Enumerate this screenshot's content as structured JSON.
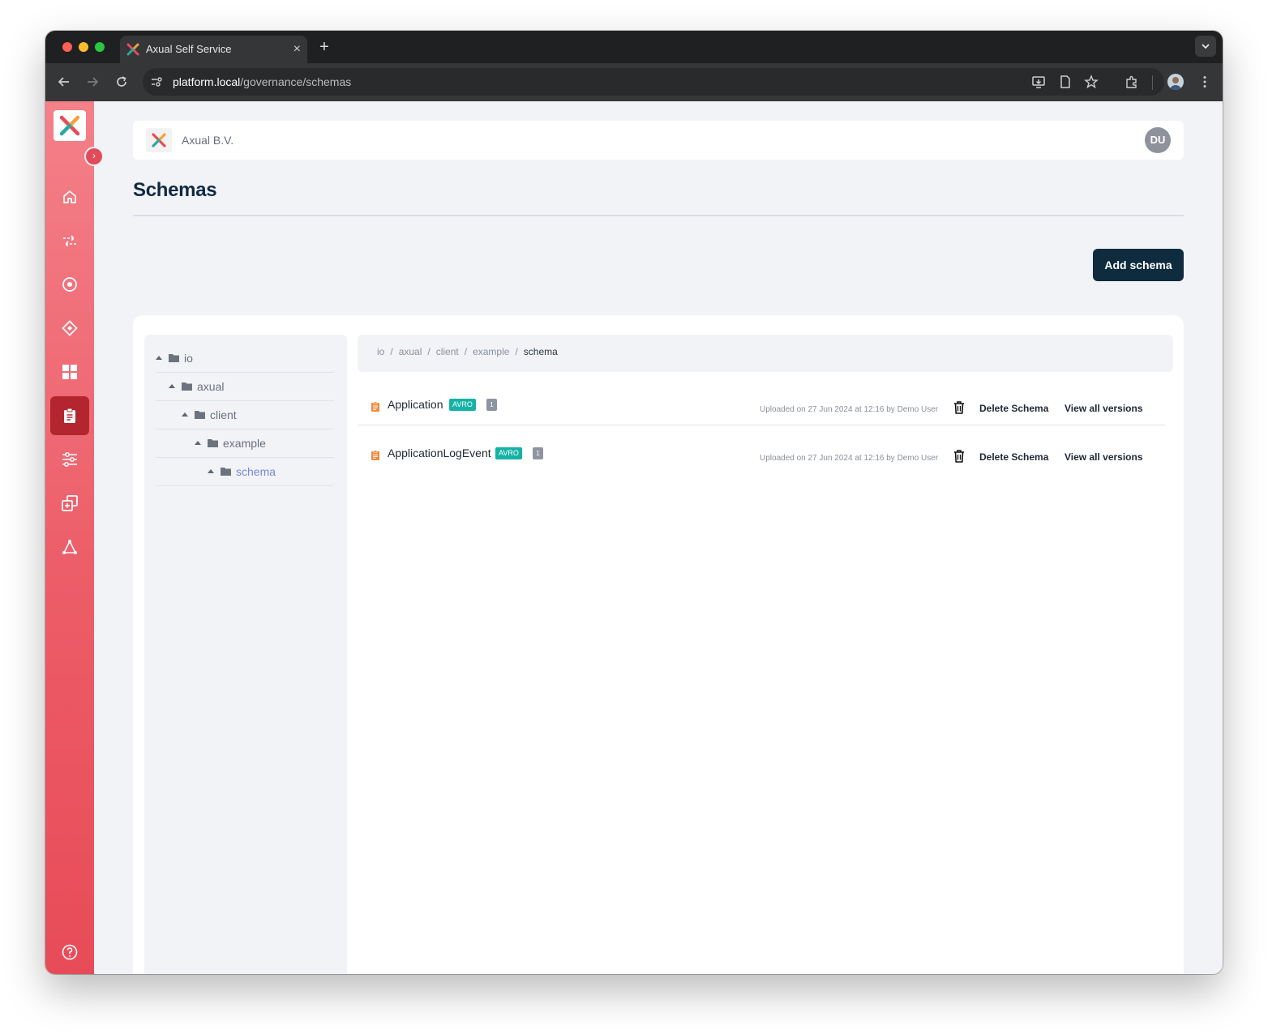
{
  "browser": {
    "tab_title": "Axual Self Service",
    "tab_close": "×",
    "new_tab": "+",
    "url_host": "platform.local",
    "url_path": "/governance/schemas"
  },
  "sidebar": {
    "expand_glyph": "›",
    "items": [
      {
        "icon": "home-icon"
      },
      {
        "icon": "streams-icon"
      },
      {
        "icon": "environments-icon"
      },
      {
        "icon": "applications-icon"
      },
      {
        "icon": "dashboard-icon"
      },
      {
        "icon": "schemas-icon",
        "active": true
      },
      {
        "icon": "settings-sliders-icon"
      },
      {
        "icon": "copy-icon"
      },
      {
        "icon": "topology-icon"
      }
    ],
    "help_icon": "help-icon"
  },
  "header": {
    "org_name": "Axual B.V.",
    "avatar_initials": "DU"
  },
  "page": {
    "title": "Schemas",
    "add_button": "Add schema"
  },
  "tree": [
    {
      "label": "io"
    },
    {
      "label": "axual"
    },
    {
      "label": "client"
    },
    {
      "label": "example"
    },
    {
      "label": "schema",
      "active": true
    }
  ],
  "breadcrumb": [
    "io",
    "axual",
    "client",
    "example",
    "schema"
  ],
  "breadcrumb_separator": "/",
  "schemas": [
    {
      "name": "Application",
      "type": "AVRO",
      "versions": "1",
      "uploaded": "Uploaded on 27 Jun 2024 at 12:16 by Demo User",
      "delete_label": "Delete Schema",
      "versions_label": "View all versions"
    },
    {
      "name": "ApplicationLogEvent",
      "type": "AVRO",
      "versions": "1",
      "uploaded": "Uploaded on 27 Jun 2024 at 12:16 by Demo User",
      "delete_label": "Delete Schema",
      "versions_label": "View all versions"
    }
  ],
  "colors": {
    "sidebar_top": "#f48089",
    "sidebar_bottom": "#e84b58",
    "primary_button": "#0f2b3e",
    "avro_badge": "#15b3a6",
    "active_tree": "#7489d8"
  }
}
